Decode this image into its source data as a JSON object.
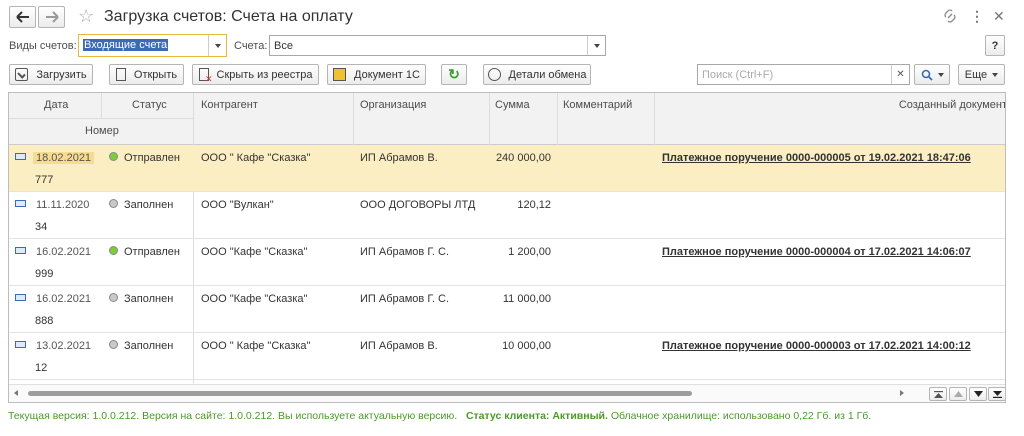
{
  "window": {
    "title": "Загрузка счетов: Счета на оплату"
  },
  "filters": {
    "kind_label": "Виды счетов:",
    "kind_value": "Входящие счета",
    "accounts_label": "Счета:",
    "accounts_value": "Все",
    "help": "?"
  },
  "toolbar": {
    "load": "Загрузить",
    "open": "Открыть",
    "hide": "Скрыть из реестра",
    "doc1c": "Документ 1С",
    "details": "Детали обмена",
    "search_placeholder": "Поиск (Ctrl+F)",
    "more": "Еще"
  },
  "table": {
    "headers": {
      "date": "Дата",
      "status": "Статус",
      "number": "Номер",
      "counterparty": "Контрагент",
      "organization": "Организация",
      "sum": "Сумма",
      "comment": "Комментарий",
      "created_doc": "Созданный документ"
    },
    "rows": [
      {
        "date": "18.02.2021",
        "number": "777",
        "status": "Отправлен",
        "counterparty": "ООО \" Кафе \"Сказка\"",
        "organization": "ИП Абрамов В.",
        "sum": "240 000,00",
        "doc": "Платежное поручение 0000-000005 от 19.02.2021 18:47:06"
      },
      {
        "date": "11.11.2020",
        "number": "34",
        "status": "Заполнен",
        "counterparty": "ООО \"Вулкан\"",
        "organization": "ООО ДОГОВОРЫ ЛТД",
        "sum": "120,12",
        "doc": ""
      },
      {
        "date": "16.02.2021",
        "number": "999",
        "status": "Отправлен",
        "counterparty": "ООО \"Кафе \"Сказка\"",
        "organization": "ИП Абрамов Г. С.",
        "sum": "1 200,00",
        "doc": "Платежное поручение 0000-000004 от 17.02.2021 14:06:07"
      },
      {
        "date": "16.02.2021",
        "number": "888",
        "status": "Заполнен",
        "counterparty": "ООО \"Кафе \"Сказка\"",
        "organization": "ИП Абрамов Г. С.",
        "sum": "11 000,00",
        "doc": ""
      },
      {
        "date": "13.02.2021",
        "number": "12",
        "status": "Заполнен",
        "counterparty": "ООО \" Кафе \"Сказка\"",
        "organization": "ИП Абрамов В.",
        "sum": "10 000,00",
        "doc": "Платежное поручение 0000-000003 от 17.02.2021 14:00:12"
      }
    ]
  },
  "statusbar": {
    "version": "Текущая версия: 1.0.0.212. Версия на сайте: 1.0.0.212. Вы используете актуальную версию.",
    "client_status": "Статус клиента: Активный.",
    "storage": "Облачное хранилище: использовано 0,22 Гб. из 1 Гб."
  },
  "colors": {
    "status_sent": "#7ccd3c",
    "status_filled": "#c9c9c9",
    "selected_row": "#fbeec2",
    "status_text": "#4a9a2a"
  }
}
